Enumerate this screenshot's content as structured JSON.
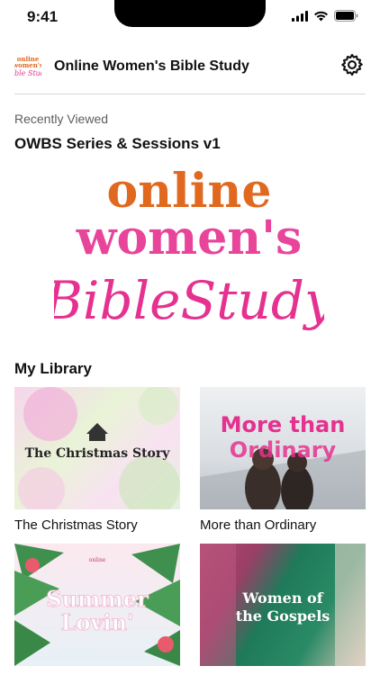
{
  "status_bar": {
    "time": "9:41"
  },
  "header": {
    "logo_text_line1": "online",
    "logo_text_line2": "women's",
    "logo_text_line3": "Bible Study",
    "title": "Online Women's Bible Study",
    "settings_icon": "gear-icon"
  },
  "recent": {
    "section_label": "Recently Viewed",
    "title": "OWBS Series & Sessions v1",
    "hero_line1": "online",
    "hero_line2": "women's",
    "hero_line3": "BibleStudy"
  },
  "library": {
    "heading": "My Library",
    "items": [
      {
        "label": "The Christmas Story",
        "thumb_text": "The Christmas Story"
      },
      {
        "label": "More than Ordinary",
        "thumb_text_line1": "More than",
        "thumb_text_line2": "Ordinary"
      },
      {
        "label": "",
        "thumb_text_line1": "Summer",
        "thumb_text_line2": "Lovin'"
      },
      {
        "label": "",
        "thumb_text_line1": "Women of",
        "thumb_text_line2": "the Gospels"
      }
    ]
  },
  "colors": {
    "orange": "#e0691f",
    "pink": "#e5318f",
    "divider": "#d6d6d6"
  }
}
